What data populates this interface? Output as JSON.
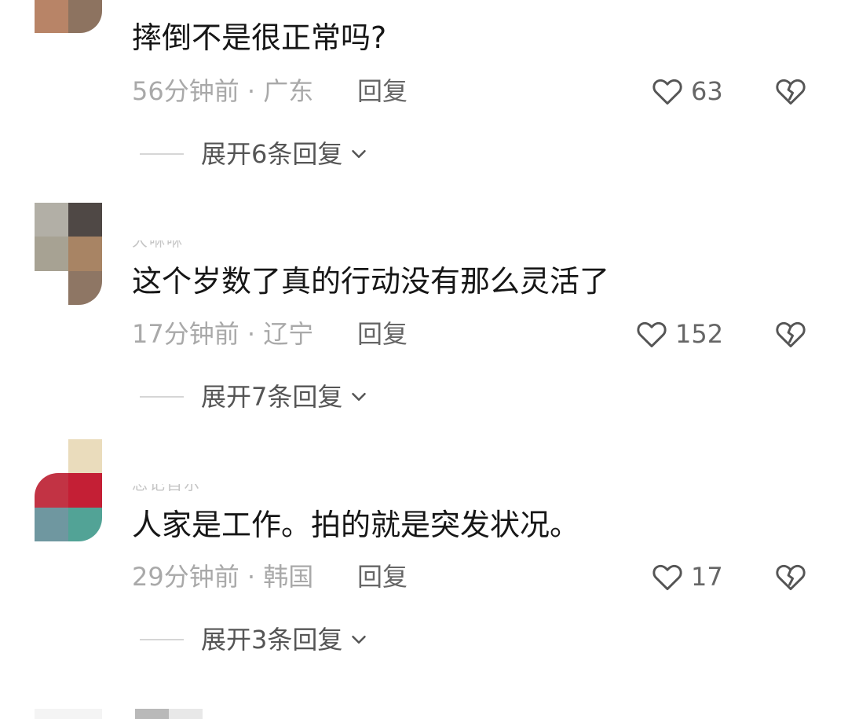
{
  "comments": [
    {
      "avatar_colors": [
        "#b88467",
        "#8d7360"
      ],
      "username": "",
      "text": "摔倒不是很正常吗?",
      "time": "56分钟前 · 广东",
      "reply_label": "回复",
      "likes": "63",
      "expand_label": "展开6条回复"
    },
    {
      "avatar_colors": [
        "#b2afa6",
        "#4f4845",
        "#a7a293",
        "#a88464",
        "#ffffff",
        "#8e7664"
      ],
      "username": "大咻咻",
      "text": "这个岁数了真的行动没有那么灵活了",
      "time": "17分钟前 · 辽宁",
      "reply_label": "回复",
      "likes": "152",
      "expand_label": "展开7条回复"
    },
    {
      "avatar_colors": [
        "#ffffff",
        "#eadcbc",
        "#c23344",
        "#c41f35",
        "#6f97a0",
        "#52a396"
      ],
      "username": "忘记自尔",
      "text": "人家是工作。拍的就是突发状况。",
      "time": "29分钟前 · 韩国",
      "reply_label": "回复",
      "likes": "17",
      "expand_label": "展开3条回复"
    }
  ],
  "icons": {
    "like": "heart-outline-icon",
    "dislike": "broken-heart-icon",
    "expand": "chevron-down-icon"
  },
  "colors": {
    "text": "#161616",
    "meta": "#a9a9a9",
    "secondary": "#666666",
    "divider": "#d6d6d6"
  }
}
